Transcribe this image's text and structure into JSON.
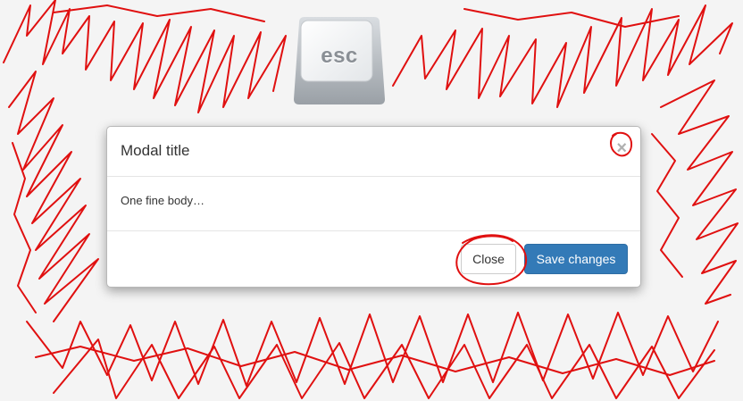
{
  "key_icon": {
    "label": "esc",
    "icon": "esc-key-icon"
  },
  "modal": {
    "title": "Modal title",
    "close_symbol": "×",
    "body": "One fine body…",
    "buttons": {
      "close_label": "Close",
      "save_label": "Save changes"
    }
  },
  "colors": {
    "background": "#f4f4f4",
    "scribble": "#e01010",
    "primary": "#337ab7"
  }
}
